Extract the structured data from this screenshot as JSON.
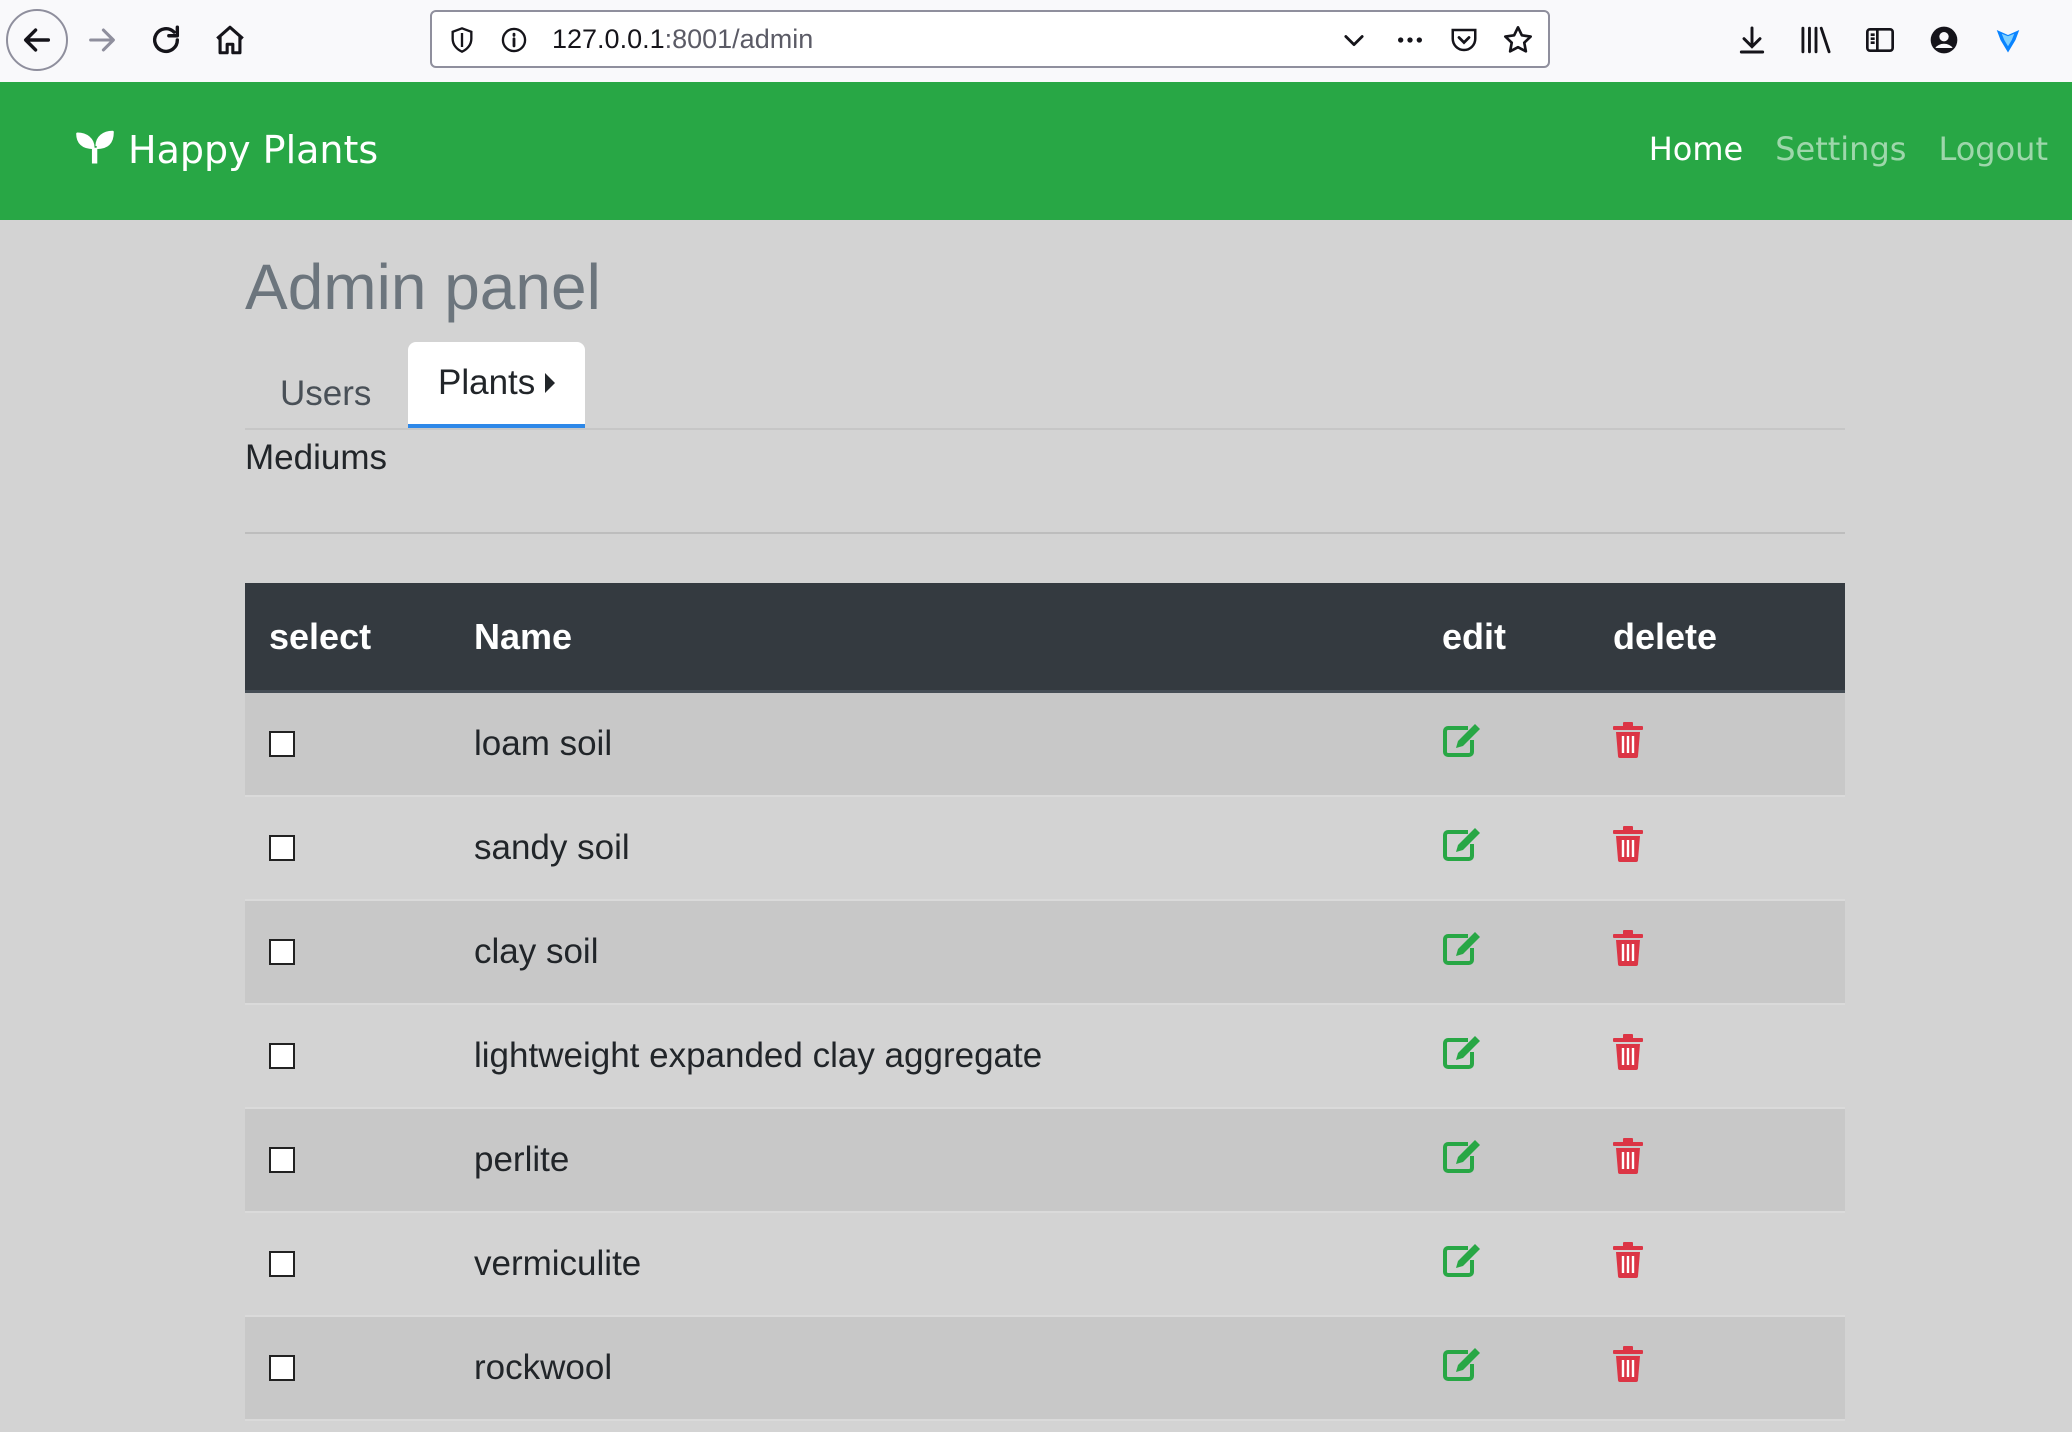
{
  "browser": {
    "url_host": "127.0.0.1",
    "url_rest": ":8001/admin",
    "icons": [
      "back-arrow-icon",
      "forward-arrow-icon",
      "reload-icon",
      "home-icon",
      "shield-icon",
      "info-icon",
      "chevron-down-icon",
      "more-icon",
      "pocket-icon",
      "star-icon",
      "download-icon",
      "library-icon",
      "sidebar-icon",
      "account-icon",
      "extension-icon"
    ]
  },
  "navbar": {
    "brand": "Happy Plants",
    "brand_icon": "seedling-icon",
    "color": "#28a745",
    "links": [
      {
        "label": "Home",
        "active": true
      },
      {
        "label": "Settings",
        "active": false
      },
      {
        "label": "Logout",
        "active": false
      }
    ]
  },
  "page": {
    "title": "Admin panel",
    "tabs": [
      {
        "label": "Users",
        "active": false
      },
      {
        "label": "Plants",
        "active": true
      }
    ],
    "subtab": "Mediums"
  },
  "table": {
    "headers": {
      "select": "select",
      "name": "Name",
      "edit": "edit",
      "delete": "delete"
    },
    "edit_color": "#28a745",
    "delete_color": "#dc3545",
    "rows": [
      {
        "name": "loam soil"
      },
      {
        "name": "sandy soil"
      },
      {
        "name": "clay soil"
      },
      {
        "name": "lightweight expanded clay aggregate"
      },
      {
        "name": "perlite"
      },
      {
        "name": "vermiculite"
      },
      {
        "name": "rockwool"
      }
    ]
  }
}
